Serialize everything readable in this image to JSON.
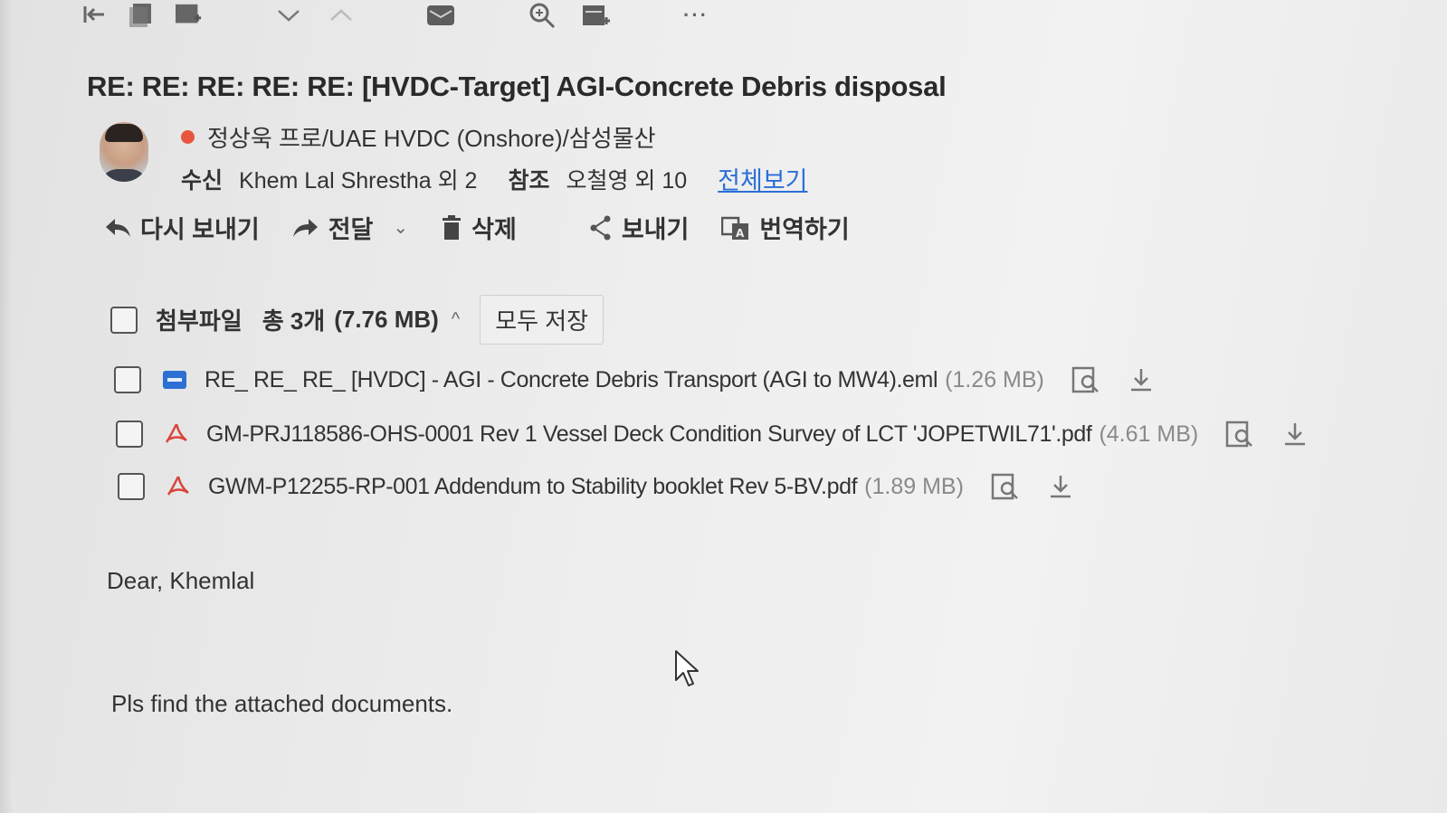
{
  "toolbar": {
    "icons": [
      "back-to-first-icon",
      "save-icon",
      "move-icon",
      "next-message-icon",
      "previous-message-icon",
      "mail-icon",
      "zoom-icon",
      "calendar-icon",
      "more-icon"
    ],
    "more_label": "···"
  },
  "email": {
    "subject": "RE: RE: RE: RE: RE: [HVDC-Target] AGI-Concrete Debris disposal",
    "sender": "정상욱 프로/UAE HVDC (Onshore)/삼성물산",
    "sender_status_color": "#e8553e",
    "to_label": "수신",
    "to_value": "Khem Lal Shrestha 외 2",
    "cc_label": "참조",
    "cc_value": "오철영 외 10",
    "view_all_label": "전체보기"
  },
  "actions": {
    "reply_label": "다시 보내기",
    "forward_label": "전달",
    "delete_label": "삭제",
    "share_label": "보내기",
    "translate_label": "번역하기"
  },
  "attachments": {
    "title": "첨부파일",
    "count_label": "총 3개",
    "total_size": "(7.76 MB)",
    "save_all_label": "모두 저장",
    "files": [
      {
        "name": "RE_ RE_ RE_ [HVDC] - AGI - Concrete Debris Transport (AGI to MW4).eml",
        "size": "(1.26 MB)",
        "type_icon": "email-file-icon"
      },
      {
        "name": "GM-PRJ118586-OHS-0001 Rev 1 Vessel Deck Condition Survey of LCT 'JOPETWIL71'.pdf",
        "size": "(4.61 MB)",
        "type_icon": "pdf-file-icon"
      },
      {
        "name": "GWM-P12255-RP-001 Addendum to Stability booklet Rev 5-BV.pdf",
        "size": "(1.89 MB)",
        "type_icon": "pdf-file-icon"
      }
    ]
  },
  "body": {
    "greeting": "Dear, Khemlal",
    "line1": "Pls find the attached documents."
  },
  "colors": {
    "link": "#2b6fd6",
    "pdf": "#d9443a",
    "email_icon": "#2d6fd3"
  }
}
